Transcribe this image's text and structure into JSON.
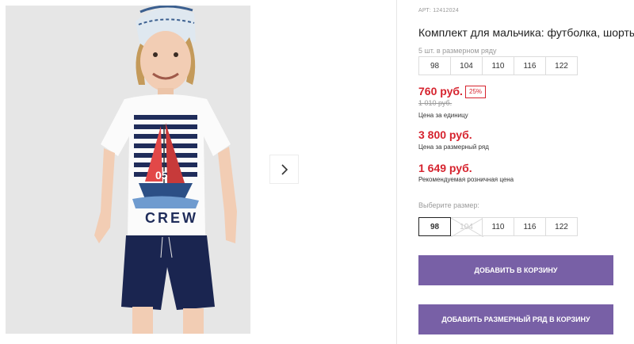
{
  "gallery": {
    "next_label": "next-image",
    "shirt_text": "CREW",
    "number_text": "05"
  },
  "product": {
    "article": "АРТ: 12412024",
    "title": "Комплект для мальчика: футболка, шорты",
    "row_note": "5 шт. в размерном ряду",
    "row_sizes": [
      "98",
      "104",
      "110",
      "116",
      "122"
    ],
    "price_unit": "760 руб.",
    "discount": "25%",
    "old_price": "1 010 руб.",
    "unit_caption": "Цена за единицу",
    "price_row": "3 800 руб.",
    "row_caption": "Цена за размерный ряд",
    "price_retail": "1 649 руб.",
    "retail_caption": "Рекомендуемая розничная цена",
    "choose_label": "Выберите размер:",
    "choose_sizes": [
      "98",
      "104",
      "110",
      "116",
      "122"
    ],
    "selected_size": "98",
    "unavailable_size": "104",
    "add_to_cart": "ДОБАВИТЬ В КОРЗИНУ",
    "add_row_to_cart": "ДОБАВИТЬ РАЗМЕРНЫЙ РЯД В КОРЗИНУ"
  },
  "colors": {
    "accent": "#7860a6",
    "price_red": "#d6232e"
  }
}
